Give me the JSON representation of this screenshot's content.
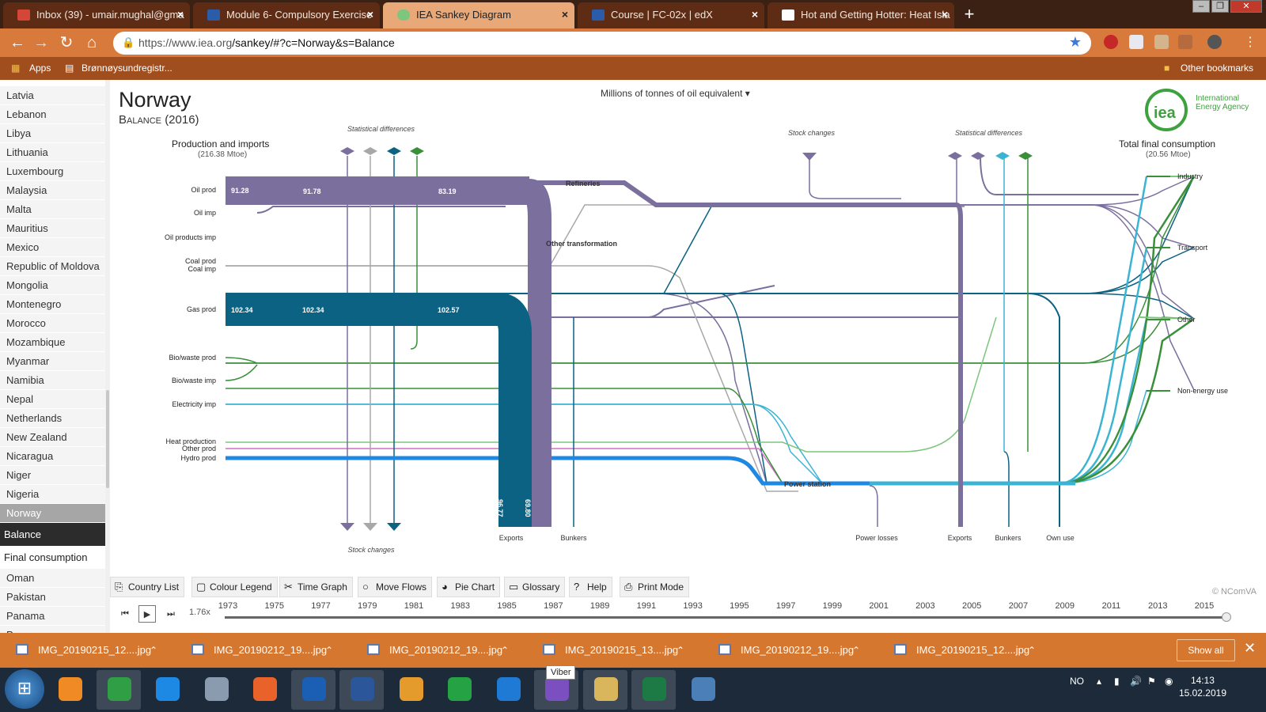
{
  "browser": {
    "tabs": [
      {
        "label": "Inbox (39) - umair.mughal@gma",
        "icon": "gmail-icon",
        "color": "#d44638"
      },
      {
        "label": "Module 6- Compulsory Exercise",
        "icon": "module-icon",
        "color": "#2a5caa"
      },
      {
        "label": "IEA Sankey Diagram",
        "icon": "iea-icon",
        "color": "#7dc67d"
      },
      {
        "label": "Course | FC-02x | edX",
        "icon": "edx-icon",
        "color": "#2a5caa"
      },
      {
        "label": "Hot and Getting Hotter: Heat Isla",
        "icon": "page-icon",
        "color": "#ffffff"
      }
    ],
    "active_tab": 2,
    "url_host": "https://www.iea.org",
    "url_path": "/sankey/#?c=Norway&s=Balance",
    "bookmarks": {
      "apps": "Apps",
      "item": "Brønnøysundregistr...",
      "other": "Other bookmarks"
    }
  },
  "sidebar": {
    "countries": [
      "Latvia",
      "Lebanon",
      "Libya",
      "Lithuania",
      "Luxembourg",
      "Malaysia",
      "Malta",
      "Mauritius",
      "Mexico",
      "Republic of Moldova",
      "Mongolia",
      "Montenegro",
      "Morocco",
      "Mozambique",
      "Myanmar",
      "Namibia",
      "Nepal",
      "Netherlands",
      "New Zealand",
      "Nicaragua",
      "Niger",
      "Nigeria",
      "Norway"
    ],
    "selected_country": "Norway",
    "modes": [
      "Balance",
      "Final consumption"
    ],
    "selected_mode": "Balance",
    "countries_after": [
      "Oman",
      "Pakistan",
      "Panama",
      "Paraguay"
    ]
  },
  "page": {
    "country": "Norway",
    "subtitle": "Balance (2016)",
    "unit_selector": "Millions of tonnes of oil equivalent",
    "logo_text": "International Energy Agency",
    "logo_mark": "iea"
  },
  "chart_data": {
    "type": "sankey",
    "left_header": {
      "title": "Production and imports",
      "total": "(216.38 Mtoe)"
    },
    "right_header": {
      "title": "Total final consumption",
      "total": "(20.56 Mtoe)"
    },
    "sources": [
      "Oil prod",
      "Oil imp",
      "Oil products imp",
      "Coal prod",
      "Coal imp",
      "Gas prod",
      "Bio/waste prod",
      "Bio/waste imp",
      "Electricity imp",
      "Heat production",
      "Other prod",
      "Hydro prod"
    ],
    "sinks": [
      "Industry",
      "Transport",
      "Other",
      "Non-energy use"
    ],
    "top_labels": [
      "Statistical differences",
      "Stock changes",
      "Statistical differences"
    ],
    "bottom_labels": [
      "Stock changes",
      "Exports",
      "Bunkers",
      "Power losses",
      "Exports",
      "Bunkers",
      "Own use"
    ],
    "nodes": [
      "Refineries",
      "Other transformation",
      "Power station"
    ],
    "oil_values": [
      "91.28",
      "91.78",
      "83.19"
    ],
    "gas_values": [
      "102.34",
      "102.34",
      "102.57"
    ],
    "exports": [
      {
        "name": "Gas exports",
        "value": "96.77"
      },
      {
        "name": "Oil exports",
        "value": "69.80"
      }
    ],
    "colors": {
      "oil": "#7b6f9e",
      "gas": "#0c6283",
      "hydro": "#1e88e5",
      "elec": "#3bb4d4",
      "bio": "#3a8f3a",
      "heat": "#7cc67c",
      "other": "#d36fc1",
      "coal": "#a8a8a8"
    }
  },
  "toolbar": {
    "buttons": [
      {
        "label": "Country List",
        "icon": "list-icon"
      },
      {
        "label": "Colour Legend",
        "icon": "legend-icon"
      },
      {
        "label": "Time Graph",
        "icon": "timegraph-icon"
      },
      {
        "label": "Move Flows",
        "icon": "circle-icon"
      },
      {
        "label": "Pie Chart",
        "icon": "pie-icon"
      },
      {
        "label": "Glossary",
        "icon": "book-icon"
      },
      {
        "label": "Help",
        "icon": "help-icon"
      },
      {
        "label": "Print Mode",
        "icon": "print-icon"
      }
    ],
    "credit": "© NComVA"
  },
  "timeline": {
    "zoom": "1.76x",
    "years": [
      "1973",
      "1975",
      "1977",
      "1979",
      "1981",
      "1983",
      "1985",
      "1987",
      "1989",
      "1991",
      "1993",
      "1995",
      "1997",
      "1999",
      "2001",
      "2003",
      "2005",
      "2007",
      "2009",
      "2011",
      "2013",
      "2015"
    ]
  },
  "downloads": {
    "items": [
      "IMG_20190215_12....jpg",
      "IMG_20190212_19....jpg",
      "IMG_20190212_19....jpg",
      "IMG_20190215_13....jpg",
      "IMG_20190212_19....jpg",
      "IMG_20190215_12....jpg"
    ],
    "show_all": "Show all",
    "tooltip": "Viber"
  },
  "taskbar": {
    "apps": [
      "hand-icon",
      "chrome-icon",
      "skype-icon",
      "paint-icon",
      "firefox-icon",
      "outlook-icon",
      "word-icon",
      "media-icon",
      "whatsapp-icon",
      "ie-icon",
      "viber-icon",
      "explorer-icon",
      "excel-icon",
      "photos-icon"
    ],
    "lang": "NO",
    "time": "14:13",
    "date": "15.02.2019"
  }
}
